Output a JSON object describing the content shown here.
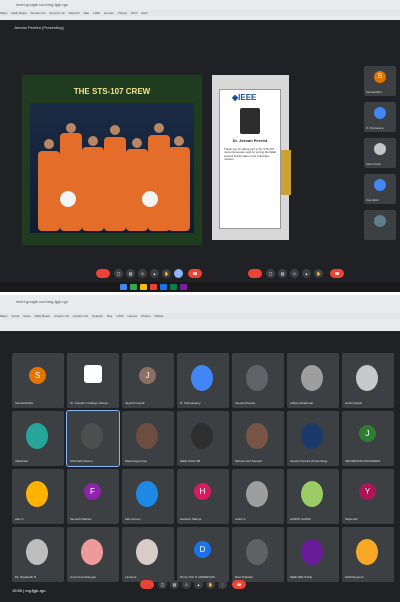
{
  "top_browser": {
    "url": "meet.google.com/mg-fjgk-rgo",
    "bookmarks": [
      "Maps",
      "Daily Beast",
      "Amazon.IN",
      "Amazon.10",
      "Network",
      "Rae",
      "LIMS",
      "Heroes",
      "Photos",
      "NCC",
      "ELD"
    ]
  },
  "top_meet": {
    "presenter": "Jeevan Pereira (Presenting)",
    "slide_title": "THE STS-107 CREW",
    "certificate": {
      "logo": "◆IEEE",
      "name": "Dr. Jeevan Pereira",
      "body": "Thank you for taking part in the STS-107 memorial session and for joining the IEEE student branch talk on the Columbia mission."
    },
    "side_participants": [
      {
        "initial": "S",
        "name": "Sai Harshitha",
        "color": "#e37400"
      },
      {
        "initial": "",
        "name": "R. Chinnasamy",
        "color": "#4285f4"
      },
      {
        "initial": "",
        "name": "Harini Gopal",
        "color": "#c5c5c5"
      },
      {
        "initial": "",
        "name": "Sree lahari",
        "color": "#4285f4"
      },
      {
        "initial": "",
        "name": "",
        "color": "#607d8b"
      }
    ]
  },
  "bottom_browser": {
    "url": "meet.google.com/mg-fjgk-rgo",
    "bookmarks": [
      "Maps",
      "Gmail",
      "News",
      "Daily Beast",
      "Amazon.IN",
      "Amazon.10",
      "Network",
      "Rae",
      "LIMS",
      "Heroes",
      "Photos",
      "Mobile"
    ]
  },
  "bottom_meet": {
    "participants": [
      {
        "name": "Sai Harshitha",
        "initial": "S",
        "color": "#e37400",
        "kind": "initial"
      },
      {
        "name": "St. Joseph's College of Engi...",
        "initial": "",
        "color": "#ffffff",
        "kind": "logo"
      },
      {
        "name": "Jayanth Gopal",
        "initial": "J",
        "color": "#8d6e63",
        "kind": "initial"
      },
      {
        "name": "R. Chinnasamy",
        "initial": "",
        "color": "#4285f4",
        "kind": "photo"
      },
      {
        "name": "Jeevan Pereira",
        "initial": "",
        "color": "#5f6368",
        "kind": "photo"
      },
      {
        "name": "Aditya Sivakumar",
        "initial": "",
        "color": "#9e9e9e",
        "kind": "photo"
      },
      {
        "name": "Harini Gopal",
        "initial": "",
        "color": "#c8c8c8",
        "kind": "photo"
      },
      {
        "name": "Vaishnavi",
        "initial": "",
        "color": "#26a69a",
        "kind": "photo"
      },
      {
        "name": "Shrenidhi Menon",
        "initial": "",
        "color": "#4e4e4e",
        "kind": "photo"
      },
      {
        "name": "Shanmuga priya",
        "initial": "",
        "color": "#6d4c41",
        "kind": "photo"
      },
      {
        "name": "IEEE SJCE SB",
        "initial": "",
        "color": "#2e2e2e",
        "kind": "photo"
      },
      {
        "name": "Mohammed Sameer",
        "initial": "",
        "color": "#795548",
        "kind": "photo"
      },
      {
        "name": "Jeevan Pereira (Presenting)",
        "initial": "",
        "color": "#1b3a6b",
        "kind": "photo"
      },
      {
        "name": "JEFFERSON PACHAIRAJ",
        "initial": "J",
        "color": "#2e7d32",
        "kind": "initial"
      },
      {
        "name": "Alex A",
        "initial": "",
        "color": "#ffb300",
        "kind": "photo"
      },
      {
        "name": "Tanushri Mohan",
        "initial": "F",
        "color": "#8e24aa",
        "kind": "initial"
      },
      {
        "name": "Alex Antony",
        "initial": "",
        "color": "#1e88e5",
        "kind": "photo"
      },
      {
        "name": "Harshini Sathya",
        "initial": "H",
        "color": "#d81b60",
        "kind": "initial"
      },
      {
        "name": "ALEX A",
        "initial": "",
        "color": "#9e9e9e",
        "kind": "photo"
      },
      {
        "name": "HARINI GOPAL",
        "initial": "",
        "color": "#9ccc65",
        "kind": "photo"
      },
      {
        "name": "Sejal shin",
        "initial": "Y",
        "color": "#ad1457",
        "kind": "initial"
      },
      {
        "name": "Mr. Sivakanth R",
        "initial": "",
        "color": "#bdbdbd",
        "kind": "photo"
      },
      {
        "name": "Uma Uma Murugan",
        "initial": "",
        "color": "#ef9a9a",
        "kind": "photo"
      },
      {
        "name": "Lavanya",
        "initial": "",
        "color": "#d7ccc8",
        "kind": "photo"
      },
      {
        "name": "Dhruv Shri N ANDERSON",
        "initial": "D",
        "color": "#1a73e8",
        "kind": "initial"
      },
      {
        "name": "Ravi Prakash",
        "initial": "",
        "color": "#616161",
        "kind": "photo"
      },
      {
        "name": "IEEE WIE SJCE",
        "initial": "",
        "color": "#6a1b9a",
        "kind": "photo"
      },
      {
        "name": "Karthikeyan E",
        "initial": "",
        "color": "#f9a825",
        "kind": "photo"
      }
    ],
    "time": "19:55",
    "meeting_code": "mg-fjgk-rgo"
  }
}
